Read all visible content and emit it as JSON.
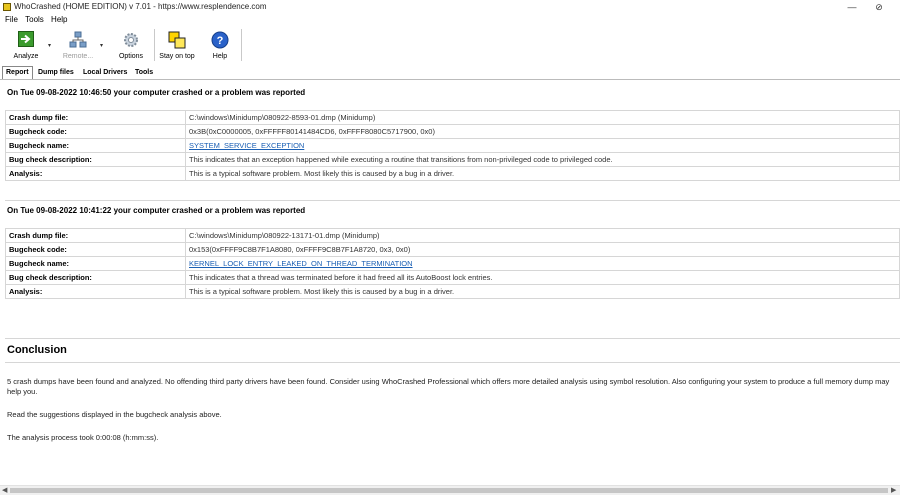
{
  "window": {
    "title": "WhoCrashed  (HOME EDITION)  v 7.01  -  https://www.resplendence.com",
    "minimize_glyph": "—",
    "close_glyph": "⊘"
  },
  "menu": [
    "File",
    "Tools",
    "Help"
  ],
  "toolbar": {
    "analyze": "Analyze",
    "remote": "Remote...",
    "options": "Options",
    "stay_on_top": "Stay on top",
    "help": "Help"
  },
  "tabs": [
    "Report",
    "Dump files",
    "Local Drivers",
    "Tools"
  ],
  "reports": [
    {
      "heading": "On Tue 09-08-2022 10:46:50 your computer crashed or a problem was reported",
      "rows": [
        {
          "key": "Crash dump file:",
          "value": "C:\\windows\\Minidump\\080922-8593-01.dmp (Minidump)"
        },
        {
          "key": "Bugcheck code:",
          "value": "0x3B(0xC0000005, 0xFFFFF80141484CD6, 0xFFFF8080C5717900, 0x0)"
        },
        {
          "key": "Bugcheck name:",
          "value": "SYSTEM_SERVICE_EXCEPTION",
          "link": true
        },
        {
          "key": "Bug check description:",
          "value": "This indicates that an exception happened while executing a routine that transitions from non-privileged code to privileged code."
        },
        {
          "key": "Analysis:",
          "value": "This is a typical software problem. Most likely this is caused by a bug in a driver."
        }
      ]
    },
    {
      "heading": "On Tue 09-08-2022 10:41:22 your computer crashed or a problem was reported",
      "rows": [
        {
          "key": "Crash dump file:",
          "value": "C:\\windows\\Minidump\\080922-13171-01.dmp (Minidump)"
        },
        {
          "key": "Bugcheck code:",
          "value": "0x153(0xFFFF9C8B7F1A8080, 0xFFFF9C8B7F1A8720, 0x3, 0x0)"
        },
        {
          "key": "Bugcheck name:",
          "value": "KERNEL_LOCK_ENTRY_LEAKED_ON_THREAD_TERMINATION",
          "link": true
        },
        {
          "key": "Bug check description:",
          "value": "This indicates that a thread was terminated before it had freed all its AutoBoost lock entries."
        },
        {
          "key": "Analysis:",
          "value": "This is a typical software problem. Most likely this is caused by a bug in a driver."
        }
      ]
    }
  ],
  "conclusion": {
    "title": "Conclusion",
    "paragraphs": [
      "5 crash dumps have been found and analyzed. No offending third party drivers have been found. Consider using WhoCrashed Professional which offers more detailed analysis using symbol resolution. Also configuring your system to produce a full memory dump may help you.",
      "Read the suggestions displayed in the bugcheck analysis above.",
      "The analysis process took 0:00:08 (h:mm:ss)."
    ]
  },
  "scrollbar": {
    "left_arrow": "◀",
    "right_arrow": "▶"
  }
}
